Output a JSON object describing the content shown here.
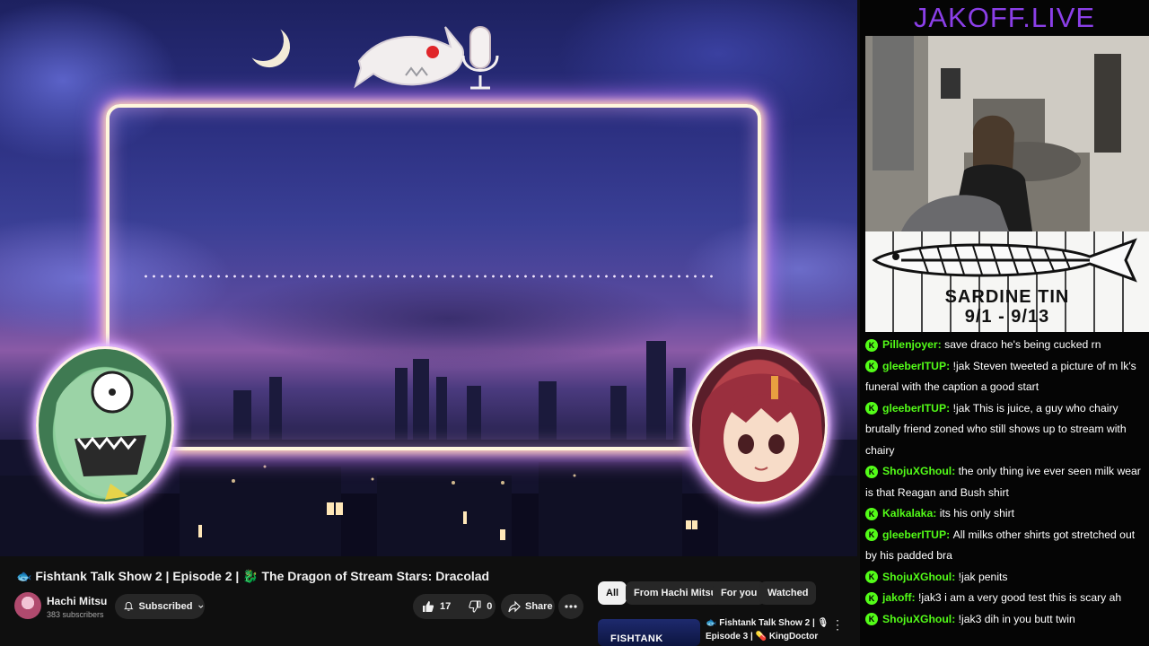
{
  "player": {
    "frame_color": "#fff6dc",
    "glow_color": "#c77dff"
  },
  "video": {
    "title": "🐟 Fishtank Talk Show 2 | Episode 2 | 🐉 The Dragon of Stream Stars: Dracolad",
    "channel_name": "Hachi Mitsu",
    "subscribers": "383 subscribers",
    "subscribe_label": "Subscribed",
    "likes": "17",
    "dislikes": "0",
    "share_label": "Share"
  },
  "recommendations": {
    "chips": [
      "All",
      "From Hachi Mitsu",
      "For you",
      "Watched"
    ],
    "active_chip": "All",
    "item": {
      "thumb_text": "FISHTANK",
      "title_line1": "🐟 Fishtank Talk Show 2 | 🎙",
      "title_line2": "Episode 3 | 💊 KingDoctor"
    }
  },
  "stream": {
    "brand": "JAKOFF.LIVE",
    "brand_color": "#8b3fe8",
    "banner_title": "SARDINE TIN",
    "banner_dates": "9/1 - 9/13"
  },
  "chat": {
    "badge_letter": "K",
    "username_color": "#53fc18",
    "messages": [
      {
        "user": "Pillenjoyer",
        "text": "save draco he's being cucked rn"
      },
      {
        "user": "gleeberITUP",
        "text": "!jak Steven tweeted a picture of m lk's funeral with the caption a good start"
      },
      {
        "user": "gleeberITUP",
        "text": "!jak This is juice, a guy who chairy brutally friend zoned who still shows up to stream with chairy"
      },
      {
        "user": "ShojuXGhoul",
        "text": "the only thing ive ever seen milk wear is that Reagan and Bush shirt"
      },
      {
        "user": "Kalkalaka",
        "text": "its his only shirt"
      },
      {
        "user": "gleeberITUP",
        "text": "All milks other shirts got stretched out by his padded bra"
      },
      {
        "user": "ShojuXGhoul",
        "text": "!jak penits"
      },
      {
        "user": "jakoff",
        "text": "!jak3 i am a very good test this is scary ah"
      },
      {
        "user": "ShojuXGhoul",
        "text": "!jak3 dih in you butt twin"
      }
    ]
  }
}
